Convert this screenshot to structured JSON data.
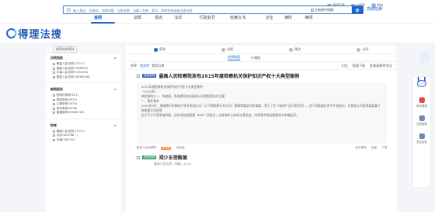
{
  "header": {
    "logo_text": "得理法搜",
    "links": [
      "APP下载",
      "小程序",
      "科技"
    ]
  },
  "nav": {
    "items": [
      "案例",
      "法规",
      "观点",
      "法讯",
      "行政处罚",
      "检察文书",
      "法宝",
      "律所",
      "律师"
    ]
  },
  "search": {
    "placeholder": "输入案由、关键词、法律问题、法院名称、当事人名称、案号、律师名称或者法规名称",
    "in_result_label": "在结果中搜索",
    "advanced_label": "高级检索"
  },
  "sidebar": {
    "head_button": "搜索结果筛选",
    "sections": [
      {
        "title": "法院层级",
        "items": [
          "最高人民法院(17517)",
          "高级人民法院(7468967)",
          "中级人民法院(7234196)",
          "基层人民法院(18598746)"
        ]
      },
      {
        "title": "参照级别",
        "items": [
          "指导性案例(451)",
          "典型案例(4522)",
          "公报案例(1629)",
          "参考案例(4598)",
          "普通案例(23683728)"
        ]
      },
      {
        "title": "地域",
        "items": [
          "最高人民法院(17517)",
          "北京(624768...)",
          "天津(336742)"
        ]
      }
    ]
  },
  "main": {
    "tabs": [
      "案例",
      "法规",
      "观点",
      "法讯"
    ],
    "subtabs": [
      "检察院案",
      "行政处"
    ],
    "sort": {
      "label": "排序:",
      "relevance": "相关性",
      "date": "裁判日期",
      "actions": [
        "对比",
        "批量下载",
        "批量复制并导出"
      ]
    },
    "results": [
      {
        "tag": "典型案例",
        "title": "最高人民检察院发布2015年度检察机关保护知识产权十大典型案例",
        "body": [
          "2015年度检察机关保护知识产权十大典型案例",
          "（2016年）",
          "典型案例之一：陈晓冀、陈海侵犯商业秘密以及侵犯职务作品案",
          "一、案件事实",
          "2003年4月，珠海德仕利微电子科技有限公司（以下简称德仕利公司）董事胡某某与陈某某，签订了为《电源产品开发合同》，由于胡某某在合作中途退出，后期该公司由胡某某妻子陈晓冀主导经营",
          "由于不公平竞争被举报，经市场监督管理（WIP）侦查后，由珠海市公安局立案侦查，并将案件移送检察机关审查起诉。"
        ],
        "meta": {
          "court": "最高人民检察院",
          "badge": "2016",
          "views": "阅读量",
          "actions": [
            "相关推荐",
            "收藏",
            "下载"
          ]
        }
      },
      {
        "tag": "指导案例",
        "title": "郑少东受贿案",
        "sub": "最高人民法院 | 刑事 | 2015"
      }
    ]
  },
  "right_float": {
    "items": [
      "新法速递",
      "在线客服",
      "意见反馈"
    ]
  },
  "colors": {
    "primary": "#1a66cf",
    "tag_blue": "#3c63c8",
    "tag_green": "#3ca06e",
    "badge_orange": "#ff8a3d"
  }
}
